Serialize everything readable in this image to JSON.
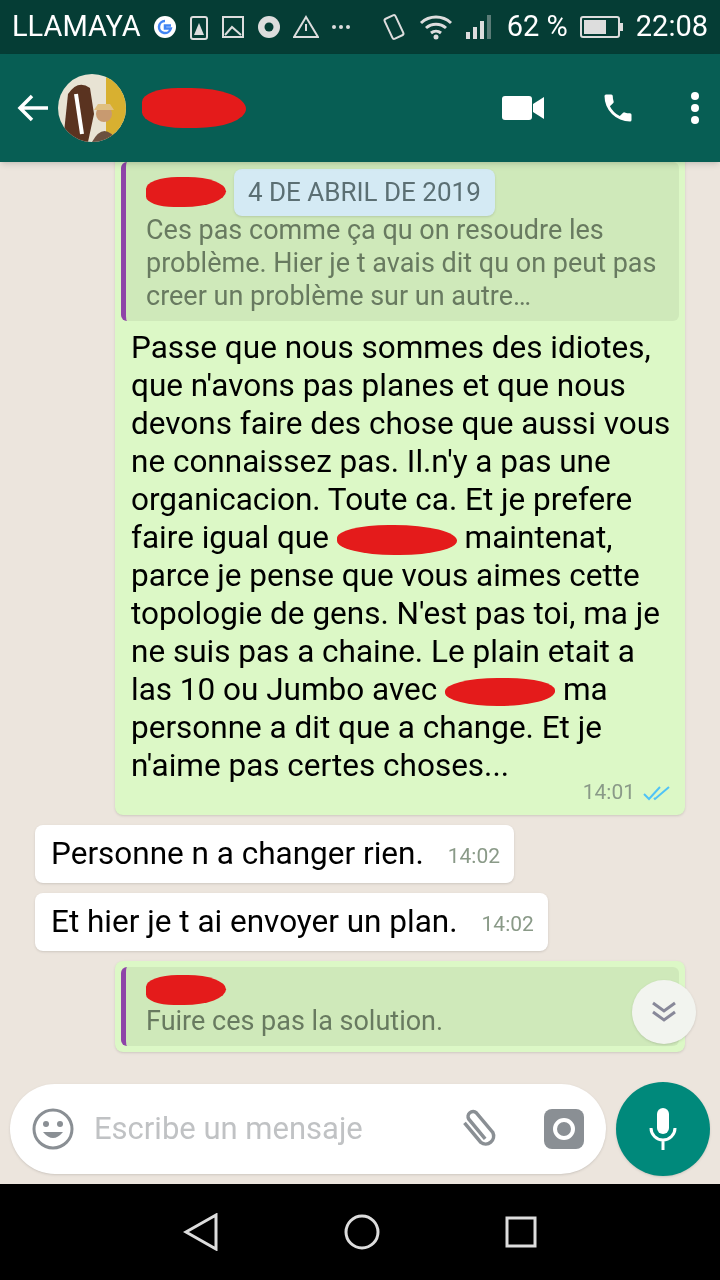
{
  "status_bar": {
    "carrier": "LLAMAYA",
    "battery_percent": "62 %",
    "time": "22:08"
  },
  "chat_header": {
    "contact_name_redacted": true
  },
  "date_chip": "4 DE ABRIL DE 2019",
  "messages": [
    {
      "kind": "outgoing",
      "quote": {
        "author_redacted": true,
        "text": "Ces pas comme ça qu on resoudre les problème. Hier je t avais dit qu on peut pas creer un problème sur un autre…"
      },
      "parts": [
        "Passe que nous sommes des idiotes, que n'avons pas planes et que nous devons faire des chose que aussi vous ne connaissez pas. Il.n'y a pas une organicacion. Toute ca. Et je prefere faire igual que",
        "maintenat, parce je pense que vous aimes cette topologie de gens. N'est pas toi, ma je ne suis pas a chaine. Le plain etait a las 10 ou Jumbo avec",
        "ma personne a dit que a change. Et je n'aime pas certes choses..."
      ],
      "time": "14:01",
      "read": true
    },
    {
      "kind": "incoming",
      "parts": [
        "Personne n a changer rien."
      ],
      "time": "14:02"
    },
    {
      "kind": "incoming",
      "parts": [
        "Et hier je t ai envoyer un plan."
      ],
      "time": "14:02"
    },
    {
      "kind": "outgoing",
      "quote": {
        "author_redacted": true,
        "text": "Fuire ces pas la solution."
      }
    }
  ],
  "composer": {
    "placeholder": "Escribe un mensaje"
  }
}
